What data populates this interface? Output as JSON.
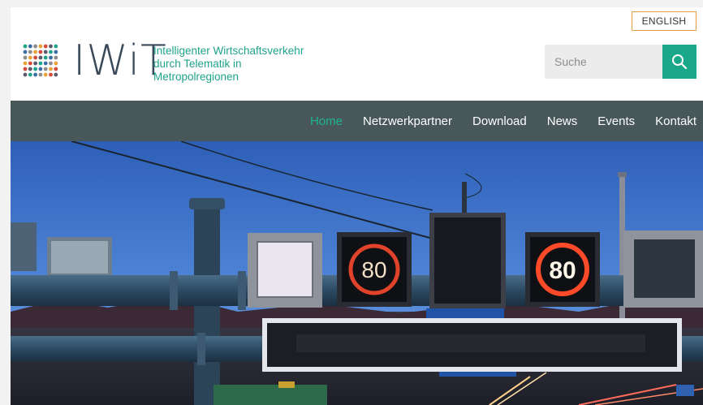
{
  "header": {
    "language_button": "ENGLISH",
    "logo_text": "IWiT",
    "tagline": [
      "Intelligenter Wirtschaftsverkehr",
      "durch Telematik in",
      "Metropolregionen"
    ],
    "search": {
      "placeholder": "Suche",
      "icon": "search-icon"
    }
  },
  "nav": {
    "items": [
      {
        "label": "Home",
        "active": true
      },
      {
        "label": "Netzwerkpartner",
        "active": false
      },
      {
        "label": "Download",
        "active": false
      },
      {
        "label": "News",
        "active": false
      },
      {
        "label": "Events",
        "active": false
      },
      {
        "label": "Kontakt",
        "active": false
      }
    ]
  },
  "hero": {
    "description": "",
    "signs": [
      {
        "value": "80",
        "lit": false
      },
      {
        "value": "80",
        "lit": true
      }
    ]
  },
  "colors": {
    "accent": "#18a889",
    "nav_background": "#47575a",
    "nav_active": "#1fb592",
    "language_border": "#e3a24a",
    "wordmark": "#3a4a5a"
  }
}
